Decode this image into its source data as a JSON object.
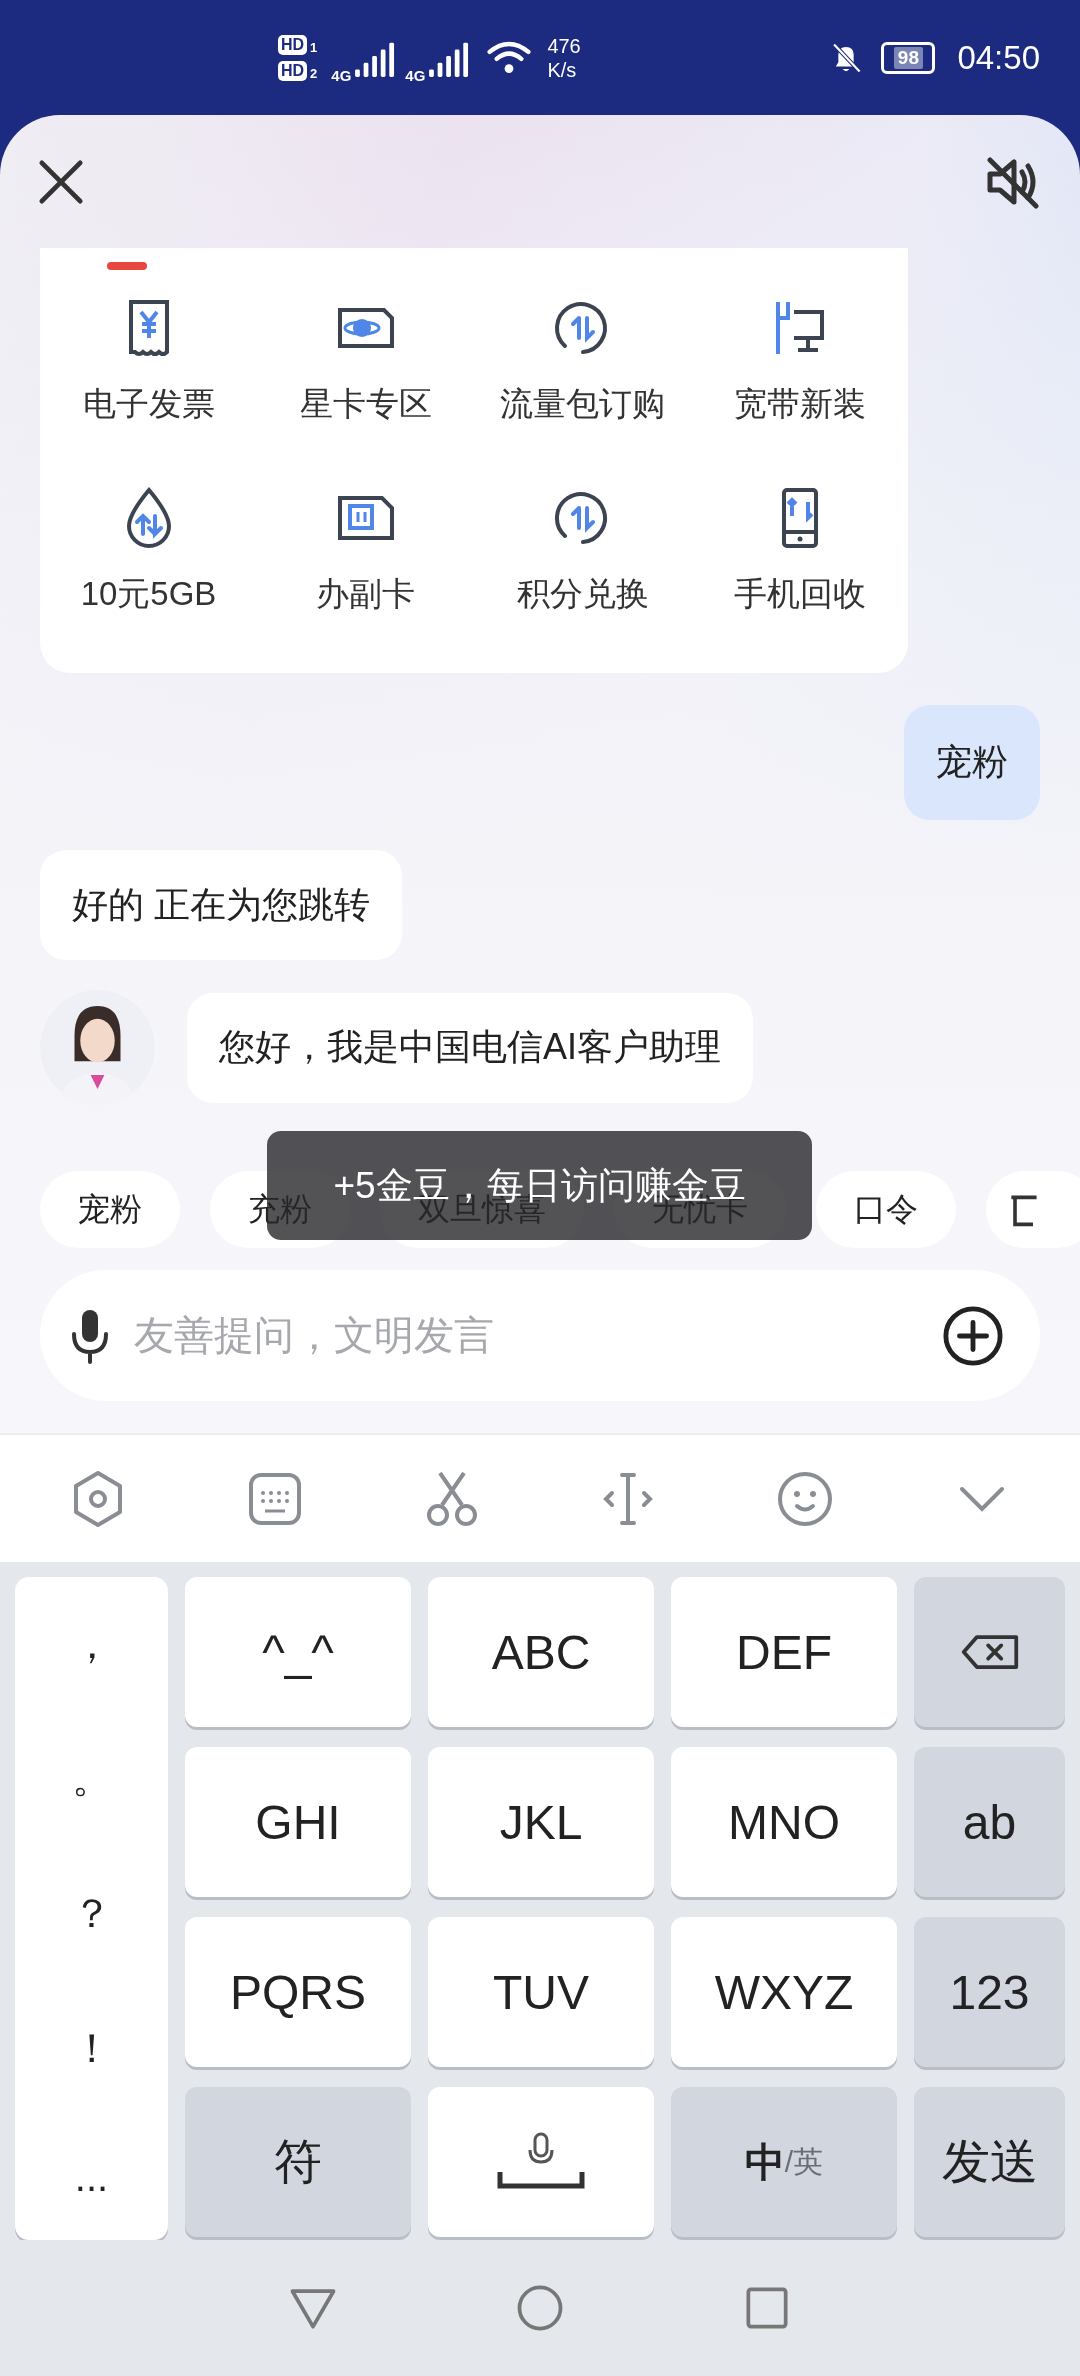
{
  "status_bar": {
    "hd_badges": [
      {
        "label": "HD",
        "slot": "1"
      },
      {
        "label": "HD",
        "slot": "2"
      }
    ],
    "networks": [
      "4G",
      "4G"
    ],
    "speed_value": "476",
    "speed_unit": "K/s",
    "battery": "98",
    "time": "04:50"
  },
  "services": [
    {
      "kind": "invoice",
      "label": "电子发票"
    },
    {
      "kind": "planet",
      "label": "星卡专区"
    },
    {
      "kind": "cycle",
      "label": "流量包订购"
    },
    {
      "kind": "broadband",
      "label": "宽带新装"
    },
    {
      "kind": "drop",
      "label": "10元5GB"
    },
    {
      "kind": "sim",
      "label": "办副卡"
    },
    {
      "kind": "exchange",
      "label": "积分兑换"
    },
    {
      "kind": "phone",
      "label": "手机回收"
    }
  ],
  "messages": [
    {
      "kind": "user",
      "text": "宠粉"
    },
    {
      "kind": "bot",
      "text": "好的 正在为您跳转"
    },
    {
      "kind": "bot-avatar",
      "text": "您好，我是中国电信AI客户助理"
    }
  ],
  "chips": [
    {
      "kind": "text",
      "label": "宠粉"
    },
    {
      "kind": "text",
      "label": "充粉"
    },
    {
      "kind": "text",
      "label": "双旦惊喜"
    },
    {
      "kind": "text",
      "label": "无忧卡"
    },
    {
      "kind": "text",
      "label": "口令"
    },
    {
      "kind": "icon"
    }
  ],
  "toast": "+5金豆，每日访问赚金豆",
  "input": {
    "placeholder": "友善提问，文明发言"
  },
  "keyboard": {
    "symbols": [
      "，",
      "。",
      "？",
      "！",
      "..."
    ],
    "keys": [
      {
        "kind": "text",
        "label": "^_^"
      },
      {
        "kind": "text",
        "label": "ABC"
      },
      {
        "kind": "text",
        "label": "DEF"
      },
      {
        "kind": "delete"
      },
      {
        "kind": "text",
        "label": "GHI"
      },
      {
        "kind": "text",
        "label": "JKL"
      },
      {
        "kind": "text",
        "label": "MNO"
      },
      {
        "kind": "function",
        "label": "ab"
      },
      {
        "kind": "text",
        "label": "PQRS"
      },
      {
        "kind": "text",
        "label": "TUV"
      },
      {
        "kind": "text",
        "label": "WXYZ"
      },
      {
        "kind": "function",
        "label": "123"
      },
      {
        "kind": "function",
        "label": "符"
      },
      {
        "kind": "space"
      },
      {
        "kind": "language",
        "label": "中",
        "secondary": "/英"
      },
      {
        "kind": "function",
        "label": "发送"
      }
    ]
  }
}
